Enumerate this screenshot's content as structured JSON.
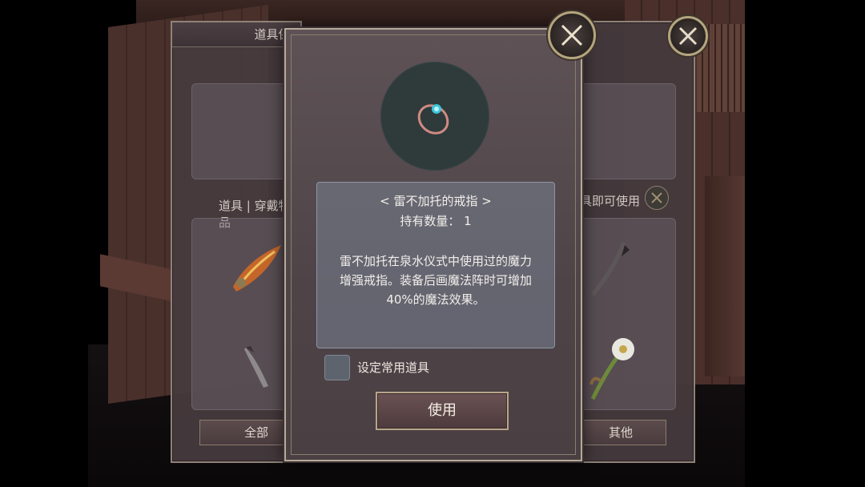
{
  "inventory": {
    "title": "道具保管箱",
    "tab_label": "道具 | 穿戴物品",
    "hint_text": "具即可使用",
    "categories": [
      "全部",
      "其他"
    ]
  },
  "item_dialog": {
    "name": "< 雷不加托的戒指 >",
    "count_label": "持有数量： 1",
    "description": "雷不加托在泉水仪式中使用过的魔力增强戒指。装备后画魔法阵时可增加40%的魔法效果。",
    "checkbox_label": "设定常用道具",
    "use_button": "使用",
    "checkbox_checked": false
  },
  "icons": {
    "close": "close-x-icon",
    "item": "ring-icon"
  },
  "colors": {
    "frame_gold": "#b6aa98",
    "panel_bg": "#4e4448",
    "desc_bg": "#78828f"
  }
}
